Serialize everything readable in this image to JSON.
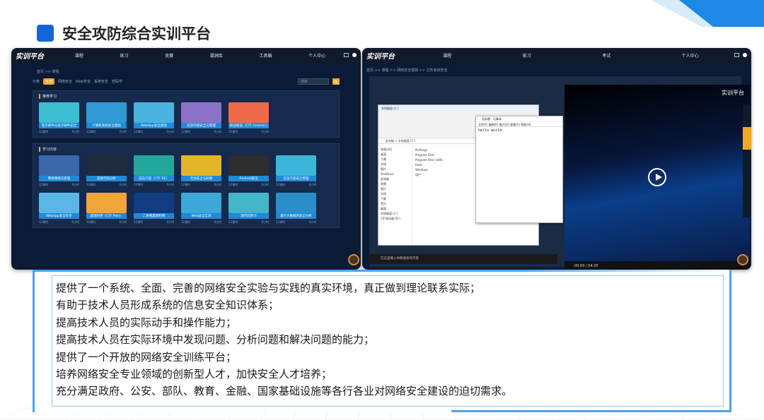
{
  "page": {
    "title": "安全攻防综合实训平台",
    "points": [
      "提供了一个系统、全面、完善的网络安全实验与实践的真实环境，真正做到理论联系实际；",
      "有助于技术人员形成系统的信息安全知识体系；",
      "提高技术人员的实际动手和操作能力；",
      "提高技术人员在实际环境中发现问题、分析问题和解决问题的能力；",
      "提供了一个开放的网络安全训练平台；",
      "培养网络安全专业领域的创新型人才，加快安全人才培养；",
      "充分满足政府、公安、部队、教育、金融、国家基础设施等各行各业对网络安全建设的迫切需求。"
    ]
  },
  "left_screenshot": {
    "logo": "实训平台",
    "nav": [
      "课程",
      "练习",
      "竞赛",
      "漏洞库",
      "工具箱",
      "个人中心"
    ],
    "crumb": "首页 >> 课程",
    "filters": [
      "分类",
      "全部",
      "网络安全",
      "Web安全",
      "系统安全",
      "密码学"
    ],
    "search_placeholder": "搜索",
    "section1": "推荐学习",
    "section2": "学习内容",
    "cards_row1": [
      {
        "caption": "电子邮件与电子邮件安全",
        "color": "#3bbfd1"
      },
      {
        "caption": "计算机系统安全基础",
        "color": "#2f9ad6"
      },
      {
        "caption": "WebApp安全基础",
        "color": "#4ab4e0"
      },
      {
        "caption": "信息内容安全与管理",
        "color": "#8b73c7"
      },
      {
        "caption": "取证取证（CTF Forensic）",
        "color": "#ef6a4a"
      }
    ],
    "cards_row2": [
      {
        "caption": "网络嗅探与管理",
        "color": "#3a68a8"
      },
      {
        "caption": "恶意代码分析",
        "color": "#1e2a3d"
      },
      {
        "caption": "逆向工程（CTF RE）",
        "color": "#23a79b"
      },
      {
        "caption": "无线安全与防御",
        "color": "#e3b52a"
      },
      {
        "caption": "Android安全",
        "color": "#2d2d2d"
      },
      {
        "caption": "信息内容安全管理",
        "color": "#3cb6d8"
      }
    ],
    "cards_row3": [
      {
        "caption": "WebApp安全综合",
        "color": "#5bb6e6"
      },
      {
        "caption": "漏洞利用（CTF Pwn）",
        "color": "#f2a33a"
      },
      {
        "caption": "二进制漏洞利用",
        "color": "#103c82"
      },
      {
        "caption": "Web安全实训",
        "color": "#3ca7d9"
      },
      {
        "caption": "源代码审计",
        "color": "#43b7c9"
      },
      {
        "caption": "基于大数据的安全分析",
        "color": "#2a8ec9"
      }
    ],
    "meta_left": "12课时",
    "meta_right": "0小时"
  },
  "right_screenshot": {
    "logo": "实训平台",
    "nav": [
      "课程",
      "练习",
      "考试",
      "个人中心"
    ],
    "crumb": "首页 >> 课程 >> 网络安全基础 >> 文件系统安全",
    "video_label": "实训平台",
    "video_time": "00:00 / 04:35",
    "notepad_title": "无标题 - 记事本",
    "notepad_menu": "文件(F)  编辑(E)  格式(O)  查看(V)  帮助(H)",
    "notepad_text": "hello world",
    "explorer_title": "本地磁盘 (C:)",
    "explorer_addr": "此电脑 > 本地磁盘 (C:)",
    "explorer_side": [
      "快速访问",
      "桌面",
      "下载",
      "文档",
      "图片",
      "OneDrive",
      "此电脑",
      "视频",
      "图片",
      "文档",
      "下载",
      "音乐",
      "桌面",
      "本地磁盘 (C:)",
      "CD 驱动器 (D:)"
    ],
    "explorer_files": [
      "PerfLogs",
      "Program Files",
      "Program Files (x86)",
      "tools",
      "Windows",
      "用户"
    ],
    "taskbar_text": "在这里输入你要搜索的内容"
  }
}
